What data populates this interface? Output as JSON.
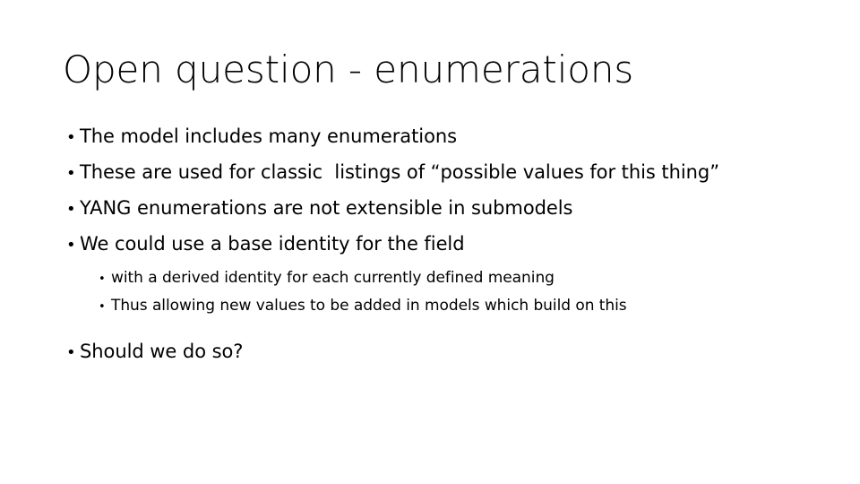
{
  "slide": {
    "background_color": "#ffffff",
    "text_color": "#000000",
    "title": "Open question - enumerations",
    "bullet_glyph": "•",
    "content": [
      {
        "level": 1,
        "text": "The model includes many enumerations"
      },
      {
        "level": 1,
        "text": "These are used for classic  listings of “possible values for this thing”"
      },
      {
        "level": 1,
        "text": "YANG enumerations are not extensible in submodels"
      },
      {
        "level": 1,
        "text": "We could use a base identity for the field"
      },
      {
        "level": 2,
        "text": "with a derived identity for each currently defined meaning"
      },
      {
        "level": 2,
        "text": "Thus allowing new values to be added in models which build on this"
      },
      {
        "level": 1,
        "text": "Should we do so?"
      }
    ]
  }
}
